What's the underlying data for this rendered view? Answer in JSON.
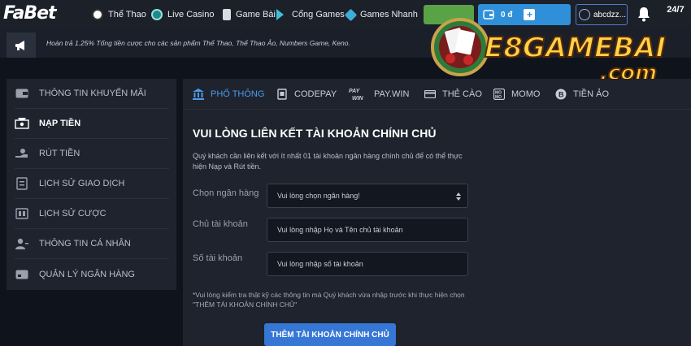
{
  "header": {
    "logo": "FaBet",
    "nav": [
      {
        "label": "Thể Thao",
        "icon": "soccer-ball-icon"
      },
      {
        "label": "Live Casino",
        "icon": "casino-chip-icon"
      },
      {
        "label": "Game Bài",
        "icon": "cards-icon"
      },
      {
        "label": "Cổng Games",
        "icon": "gamepad-icon"
      },
      {
        "label": "Games Nhanh",
        "icon": "lightning-icon"
      }
    ],
    "balance": "0 đ",
    "username": "abcdzz...",
    "support": "24/7"
  },
  "ticker": {
    "text": "Hoàn trả 1.25% Tổng tiền cược cho các sản phẩm Thể Thao, Thể Thao Ảo, Numbers Game, Keno."
  },
  "watermark": {
    "line1": "E8GAMEBAI",
    "line2": ".com"
  },
  "sidebar": {
    "items": [
      {
        "label": "THÔNG TIN KHUYẾN MÃI",
        "icon": "wallet-icon"
      },
      {
        "label": "NẠP TIỀN",
        "icon": "deposit-icon"
      },
      {
        "label": "RÚT TIỀN",
        "icon": "withdraw-icon"
      },
      {
        "label": "LỊCH SỬ GIAO DỊCH",
        "icon": "transaction-history-icon"
      },
      {
        "label": "LỊCH SỬ CƯỢC",
        "icon": "bet-history-icon"
      },
      {
        "label": "THÔNG TIN CÁ NHÂN",
        "icon": "user-profile-icon"
      },
      {
        "label": "QUẢN LÝ NGÂN HÀNG",
        "icon": "bank-card-icon"
      }
    ]
  },
  "tabs": [
    {
      "label": "PHỔ THÔNG",
      "icon": "bank-icon"
    },
    {
      "label": "CODEPAY",
      "icon": "code-icon"
    },
    {
      "label": "PAY.WIN",
      "icon": "paywin-logo-icon",
      "logo_text": "PAY WIN"
    },
    {
      "label": "THẺ CÀO",
      "icon": "card-icon"
    },
    {
      "label": "MOMO",
      "icon": "momo-logo-icon",
      "logo_text": "MO MO"
    },
    {
      "label": "TIỀN ẢO",
      "icon": "bitcoin-icon"
    }
  ],
  "form": {
    "title": "VUI LÒNG LIÊN KẾT TÀI KHOẢN CHÍNH CHỦ",
    "description": "Quý khách cần liên kết với ít nhất 01 tài khoản ngân hàng chính chủ để có thể thực hiện Nạp và Rút tiền.",
    "bank_label": "Chọn ngân hàng",
    "bank_value": "Vui lòng chọn ngân hàng!",
    "owner_label": "Chủ tài khoản",
    "owner_placeholder": "Vui lòng nhập Họ và Tên chủ tài khoản",
    "number_label": "Số tài khoản",
    "number_placeholder": "Vui lòng nhập số tài khoản",
    "note": "*Vui lòng kiểm tra thật kỹ các thông tin mà Quý khách vừa nhập trước khi thực hiện chọn \"THÊM TÀI KHOẢN CHÍNH CHỦ\"",
    "submit_label": "THÊM TÀI KHOẢN CHÍNH CHỦ"
  }
}
